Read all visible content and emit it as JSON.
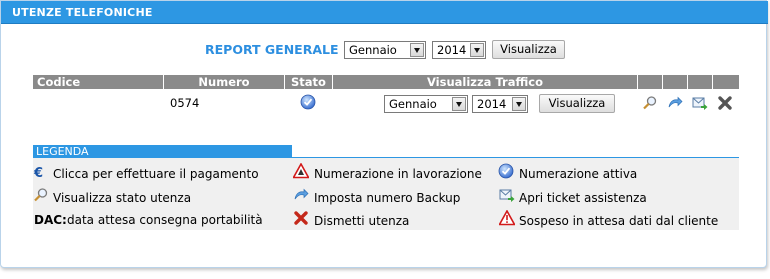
{
  "panel": {
    "title": "UTENZE TELEFONICHE"
  },
  "report": {
    "label": "REPORT GENERALE",
    "month": "Gennaio",
    "year": "2014",
    "button": "Visualizza"
  },
  "table": {
    "headers": [
      "Codice",
      "Numero",
      "Stato",
      "Visualizza Traffico"
    ],
    "row": {
      "numero": "0574",
      "stato_icon": "active-status-icon",
      "month": "Gennaio",
      "year": "2014",
      "button": "Visualizza",
      "action_icons": [
        "magnifier-icon",
        "backup-arrow-icon",
        "ticket-mail-icon",
        "delete-x-icon"
      ]
    }
  },
  "legend": {
    "title": "LEGENDA",
    "items": [
      {
        "icon": "euro-icon",
        "text": "Clicca per effettuare il pagamento"
      },
      {
        "icon": "magnifier-icon",
        "text": "Visualizza stato utenza"
      },
      {
        "icon": "",
        "bold": "DAC:",
        "text": "data attesa consegna portabilità"
      },
      {
        "icon": "work-in-progress-icon",
        "text": "Numerazione in lavorazione"
      },
      {
        "icon": "backup-arrow-icon",
        "text": "Imposta numero Backup"
      },
      {
        "icon": "delete-x-icon",
        "text": "Dismetti utenza"
      },
      {
        "icon": "active-status-icon",
        "text": "Numerazione attiva"
      },
      {
        "icon": "ticket-mail-icon",
        "text": "Apri ticket assistenza"
      },
      {
        "icon": "warning-icon",
        "text": "Sospeso in attesa dati dal cliente"
      }
    ]
  },
  "colors": {
    "accent": "#2d97e3",
    "header_gray": "#8a8a8a",
    "legend_bg": "#f0f0f0"
  }
}
